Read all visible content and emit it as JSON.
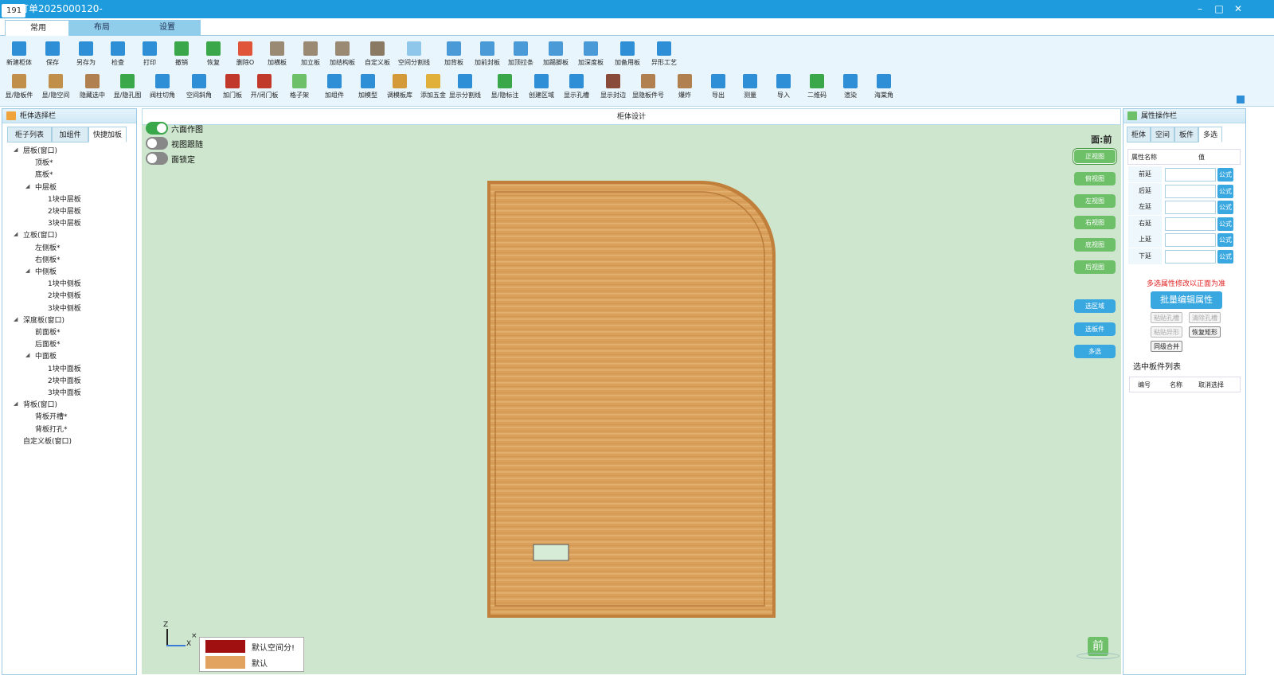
{
  "window": {
    "app_tag": "191",
    "title": "订单2025000120-",
    "controls": [
      "–",
      "□",
      "✕"
    ]
  },
  "top_tabs": [
    {
      "label": "常用",
      "active": true
    },
    {
      "label": "布局",
      "active": false
    },
    {
      "label": "设置",
      "active": false
    }
  ],
  "ribbon": {
    "row1": [
      {
        "label": "新建柜体",
        "icon": "new-cabinet-icon",
        "color": "#2e8fd6"
      },
      {
        "label": "保存",
        "icon": "save-icon",
        "color": "#2e8fd6"
      },
      {
        "label": "另存为",
        "icon": "save-as-icon",
        "color": "#2e8fd6"
      },
      {
        "label": "检查",
        "icon": "check-icon",
        "color": "#2e8fd6"
      },
      {
        "label": "打印",
        "icon": "print-icon",
        "color": "#2e8fd6"
      },
      {
        "label": "撤销",
        "icon": "undo-icon",
        "color": "#3aa84a"
      },
      {
        "label": "恢复",
        "icon": "redo-icon",
        "color": "#3aa84a"
      },
      {
        "label": "删除O",
        "icon": "delete-icon",
        "color": "#e0553a"
      },
      {
        "label": "加横板",
        "icon": "add-horizontal-board-icon",
        "color": "#9a8a74"
      },
      {
        "label": "加立板",
        "icon": "add-vertical-board-icon",
        "color": "#9a8a74"
      },
      {
        "label": "加结构板",
        "icon": "add-structure-board-icon",
        "color": "#9a8a74"
      },
      {
        "label": "自定义板",
        "icon": "custom-board-icon",
        "color": "#8a7a64"
      },
      {
        "label": "空间分割线",
        "icon": "space-divider-icon",
        "color": "#8fc7ea"
      },
      {
        "label": "加背板",
        "icon": "add-back-board-icon",
        "color": "#4a9ad8"
      },
      {
        "label": "加前封板",
        "icon": "add-front-seal-icon",
        "color": "#4a9ad8"
      },
      {
        "label": "加顶拉条",
        "icon": "add-top-strip-icon",
        "color": "#4a9ad8"
      },
      {
        "label": "加踢脚板",
        "icon": "add-kickboard-icon",
        "color": "#4a9ad8"
      },
      {
        "label": "加深度板",
        "icon": "add-depth-board-icon",
        "color": "#4a9ad8"
      },
      {
        "label": "加备用板",
        "icon": "add-spare-board-icon",
        "color": "#2e8fd6"
      },
      {
        "label": "异形工艺",
        "icon": "shape-process-icon",
        "color": "#2e8fd6"
      }
    ],
    "row2": [
      {
        "label": "显/隐板件",
        "icon": "toggle-board-icon",
        "color": "#c0904a"
      },
      {
        "label": "显/隐空间",
        "icon": "toggle-space-icon",
        "color": "#c0904a"
      },
      {
        "label": "隐藏选中",
        "icon": "hide-selected-icon",
        "color": "#b08050"
      },
      {
        "label": "显/隐孔图",
        "icon": "toggle-hole-icon",
        "color": "#3aa84a"
      },
      {
        "label": "阀柱切角",
        "icon": "pillar-cut-icon",
        "color": "#2e8fd6"
      },
      {
        "label": "空间斜角",
        "icon": "space-bevel-icon",
        "color": "#2e8fd6"
      },
      {
        "label": "加门板",
        "icon": "add-door-icon",
        "color": "#c0392b"
      },
      {
        "label": "开/闭门板",
        "icon": "open-door-icon",
        "color": "#c0392b"
      },
      {
        "label": "格子架",
        "icon": "grid-rack-icon",
        "color": "#6dbf68"
      },
      {
        "label": "加组件",
        "icon": "add-component-icon",
        "color": "#2e8fd6"
      },
      {
        "label": "加模型",
        "icon": "add-model-icon",
        "color": "#2e8fd6"
      },
      {
        "label": "调模板库",
        "icon": "template-lib-icon",
        "color": "#d49a3a"
      },
      {
        "label": "添加五金",
        "icon": "add-hardware-icon",
        "color": "#e0b03a"
      },
      {
        "label": "显示分割线",
        "icon": "show-divider-icon",
        "color": "#2e8fd6"
      },
      {
        "label": "显/隐标注",
        "icon": "toggle-annotation-icon",
        "color": "#3aa84a"
      },
      {
        "label": "创建区域",
        "icon": "create-area-icon",
        "color": "#2e8fd6"
      },
      {
        "label": "显示孔槽",
        "icon": "show-slot-icon",
        "color": "#2e8fd6"
      },
      {
        "label": "显示封边",
        "icon": "show-edge-icon",
        "color": "#8a4a3a"
      },
      {
        "label": "显隐板件号",
        "icon": "board-number-icon",
        "color": "#b08050"
      },
      {
        "label": "爆炸",
        "icon": "explode-icon",
        "color": "#b08050"
      },
      {
        "label": "导出",
        "icon": "export-icon",
        "color": "#2e8fd6"
      },
      {
        "label": "测量",
        "icon": "measure-icon",
        "color": "#2e8fd6"
      },
      {
        "label": "导入",
        "icon": "import-icon",
        "color": "#2e8fd6"
      },
      {
        "label": "二维码",
        "icon": "qrcode-icon",
        "color": "#3aa84a"
      },
      {
        "label": "渲染",
        "icon": "render-icon",
        "color": "#2e8fd6"
      },
      {
        "label": "海棠角",
        "icon": "crabapple-corner-icon",
        "color": "#2e8fd6"
      }
    ]
  },
  "left_panel": {
    "title": "柜体选择栏",
    "tabs": [
      {
        "label": "柜子列表",
        "active": false
      },
      {
        "label": "加组件",
        "active": false
      },
      {
        "label": "快捷加板",
        "active": true
      }
    ],
    "tree": [
      {
        "label": "层板(窗口)",
        "level": 0,
        "expand": "◢"
      },
      {
        "label": "顶板*",
        "level": 1
      },
      {
        "label": "底板*",
        "level": 1
      },
      {
        "label": "中层板",
        "level": 1,
        "expand": "◢"
      },
      {
        "label": "1块中层板",
        "level": 2
      },
      {
        "label": "2块中层板",
        "level": 2
      },
      {
        "label": "3块中层板",
        "level": 2
      },
      {
        "label": "立板(窗口)",
        "level": 0,
        "expand": "◢"
      },
      {
        "label": "左侧板*",
        "level": 1
      },
      {
        "label": "右侧板*",
        "level": 1
      },
      {
        "label": "中侧板",
        "level": 1,
        "expand": "◢"
      },
      {
        "label": "1块中侧板",
        "level": 2
      },
      {
        "label": "2块中侧板",
        "level": 2
      },
      {
        "label": "3块中侧板",
        "level": 2
      },
      {
        "label": "深度板(窗口)",
        "level": 0,
        "expand": "◢"
      },
      {
        "label": "前面板*",
        "level": 1
      },
      {
        "label": "后面板*",
        "level": 1
      },
      {
        "label": "中面板",
        "level": 1,
        "expand": "◢"
      },
      {
        "label": "1块中面板",
        "level": 2
      },
      {
        "label": "2块中面板",
        "level": 2
      },
      {
        "label": "3块中面板",
        "level": 2
      },
      {
        "label": "背板(窗口)",
        "level": 0,
        "expand": "◢"
      },
      {
        "label": "背板开槽*",
        "level": 1
      },
      {
        "label": "背板打孔*",
        "level": 1
      },
      {
        "label": "自定义板(窗口)",
        "level": 0
      }
    ]
  },
  "center": {
    "title": "柜体设计",
    "toggles": [
      {
        "label": "六面作图",
        "on": true
      },
      {
        "label": "视图跟随",
        "on": false
      },
      {
        "label": "面锁定",
        "on": false
      }
    ],
    "face_label": "面:前",
    "view_buttons": [
      "正视图",
      "俯视图",
      "左视图",
      "右视图",
      "底视图",
      "后视图"
    ],
    "select_buttons": [
      "选区域",
      "选板件",
      "多选"
    ],
    "axis": {
      "z": "Z",
      "x": "X",
      "close": "×"
    },
    "legend": [
      {
        "label": "默认空间分!",
        "color": "#a01010"
      },
      {
        "label": "默认",
        "color": "#e2a260"
      }
    ],
    "cube_label": "前",
    "colors": {
      "canvas_bg": "#cde6cd",
      "board_wood": "#d9a15c",
      "board_edge": "#c07f3a"
    }
  },
  "right_panel": {
    "title": "属性操作栏",
    "tabs": [
      {
        "label": "柜体",
        "active": false
      },
      {
        "label": "空间",
        "active": false
      },
      {
        "label": "板件",
        "active": false
      },
      {
        "label": "多选",
        "active": true
      }
    ],
    "header_name": "属性名称",
    "header_value": "值",
    "properties": [
      {
        "name": "前延",
        "value": "",
        "fx": "公式"
      },
      {
        "name": "后延",
        "value": "",
        "fx": "公式"
      },
      {
        "name": "左延",
        "value": "",
        "fx": "公式"
      },
      {
        "name": "右延",
        "value": "",
        "fx": "公式"
      },
      {
        "name": "上延",
        "value": "",
        "fx": "公式"
      },
      {
        "name": "下延",
        "value": "",
        "fx": "公式"
      }
    ],
    "note": "多选属性修改以正面为准",
    "batch_edit": "批量编辑属性",
    "small_buttons": [
      {
        "label": "粘贴孔槽",
        "enabled": false
      },
      {
        "label": "清除孔槽",
        "enabled": false
      },
      {
        "label": "粘贴异形",
        "enabled": false
      },
      {
        "label": "恢复矩形",
        "enabled": true
      },
      {
        "label": "同级合并",
        "enabled": true
      }
    ],
    "list_title": "选中板件列表",
    "list_columns": [
      "编号",
      "名称",
      "取消选择"
    ]
  }
}
